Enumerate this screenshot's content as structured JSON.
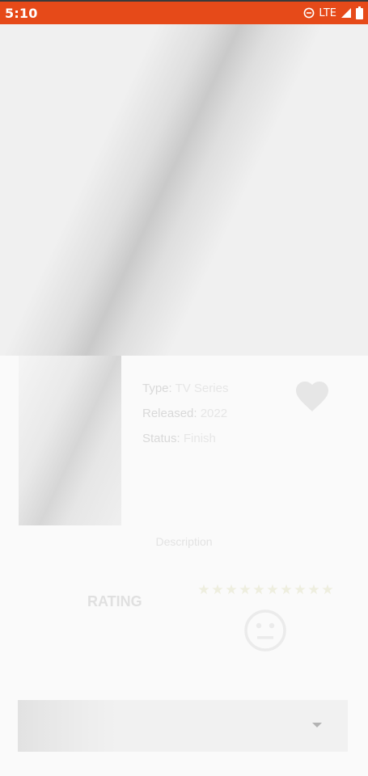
{
  "status_bar": {
    "time": "5:10",
    "network_type": "LTE",
    "icons": [
      "do-not-disturb-icon",
      "signal-icon",
      "battery-icon"
    ]
  },
  "details": {
    "type_label": "Type:",
    "type_value": "TV Series",
    "released_label": "Released:",
    "released_value": "2022",
    "status_label": "Status:",
    "status_value": "Finish"
  },
  "favorite": {
    "icon": "heart-icon"
  },
  "description": {
    "text": "Description"
  },
  "rating": {
    "label": "RATING",
    "stars_total": 10,
    "stars_filled": 0,
    "face_icon": "neutral-face-icon"
  },
  "dropdown": {
    "selected": "",
    "icon": "dropdown-arrow-icon"
  },
  "colors": {
    "status_bar": "#e64a19",
    "background": "#fafafa",
    "banner_placeholder": "#f0f0f0"
  }
}
